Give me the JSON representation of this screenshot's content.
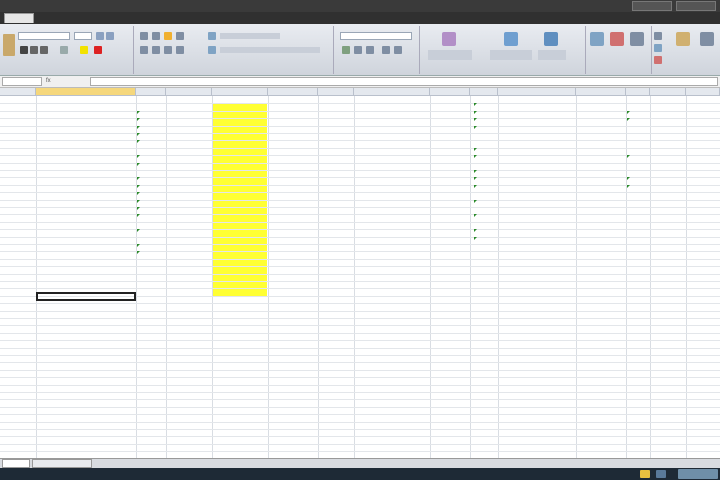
{
  "window": {
    "title": "",
    "buttons": [
      "",
      ""
    ]
  },
  "tabs": [
    {
      "label": "",
      "active": true
    },
    {
      "label": "",
      "active": false
    },
    {
      "label": "",
      "active": false
    },
    {
      "label": "",
      "active": false
    },
    {
      "label": "",
      "active": false
    },
    {
      "label": "",
      "active": false
    },
    {
      "label": "",
      "active": false
    },
    {
      "label": "",
      "active": false
    }
  ],
  "ribbon": {
    "groups": [
      {
        "label": ""
      },
      {
        "label": ""
      },
      {
        "label": ""
      },
      {
        "label": ""
      },
      {
        "label": ""
      },
      {
        "label": ""
      }
    ],
    "font_name": "",
    "font_size": "",
    "number_format": ""
  },
  "formula_bar": {
    "name_box": "",
    "fx": "fx",
    "content": ""
  },
  "grid": {
    "columns": [
      {
        "label": "",
        "selected": false
      },
      {
        "label": "",
        "selected": true
      },
      {
        "label": "",
        "selected": false
      },
      {
        "label": "",
        "selected": false
      },
      {
        "label": "",
        "selected": false
      },
      {
        "label": "",
        "selected": false
      },
      {
        "label": "",
        "selected": false
      },
      {
        "label": "",
        "selected": false
      },
      {
        "label": "",
        "selected": false
      },
      {
        "label": "",
        "selected": false
      },
      {
        "label": "",
        "selected": false
      },
      {
        "label": "",
        "selected": false
      },
      {
        "label": "",
        "selected": false
      },
      {
        "label": "",
        "selected": false
      },
      {
        "label": "",
        "selected": false
      }
    ]
  },
  "sheets": [
    {
      "label": "",
      "active": true
    },
    {
      "label": "",
      "active": false
    }
  ],
  "colors": {
    "highlight": "#ffff33",
    "ribbon": "#dde2ea",
    "selected_header": "#f5d77c"
  }
}
